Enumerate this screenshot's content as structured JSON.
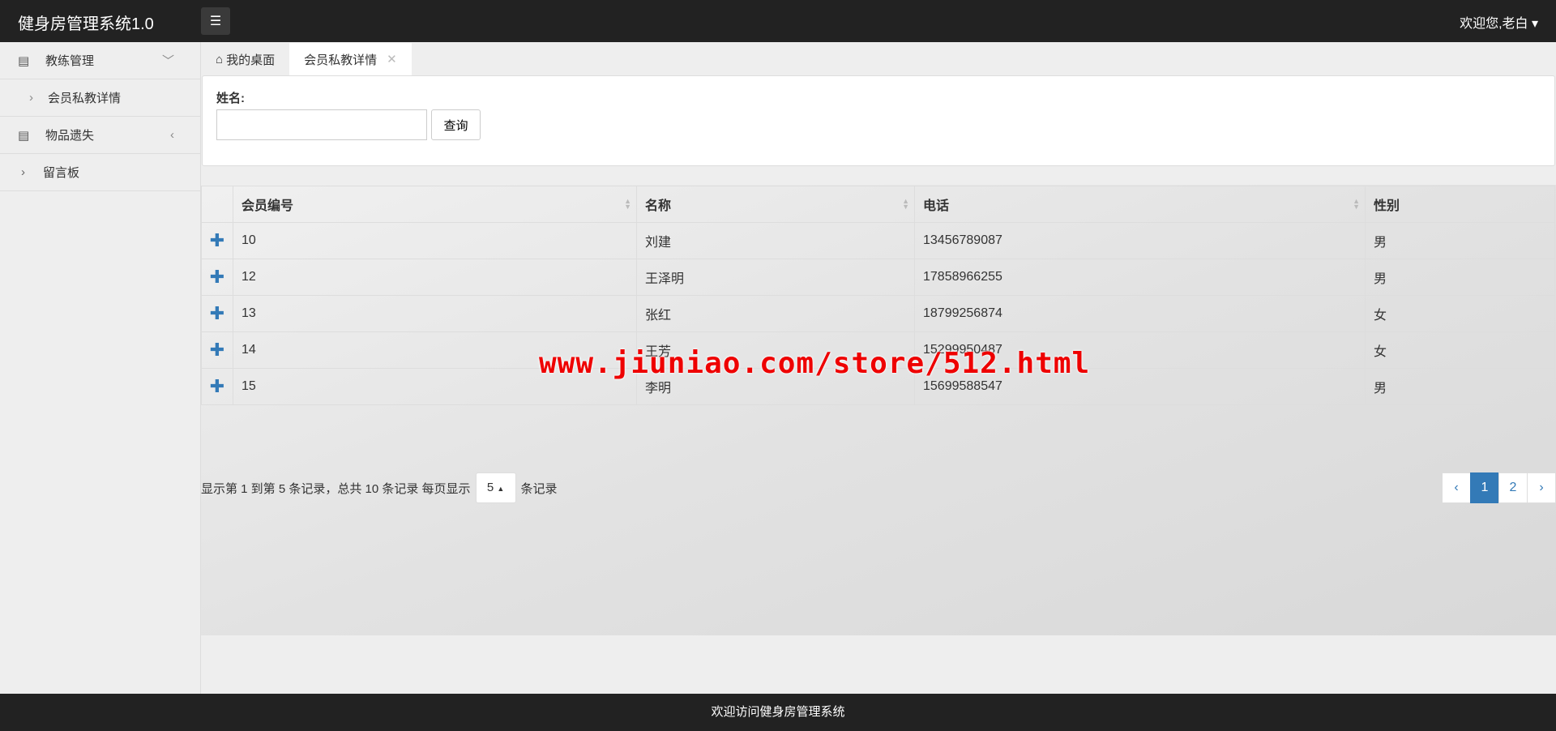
{
  "header": {
    "brand": "健身房管理系统1.0",
    "user": "欢迎您,老白"
  },
  "sidebar": {
    "items": [
      {
        "label": "教练管理",
        "children": [
          "会员私教详情"
        ]
      },
      {
        "label": "物品遗失"
      },
      {
        "label": "留言板"
      }
    ]
  },
  "tabs": [
    {
      "label": "我的桌面"
    },
    {
      "label": "会员私教详情"
    }
  ],
  "search": {
    "label": "姓名:",
    "value": "",
    "button": "查询"
  },
  "table": {
    "columns": [
      "会员编号",
      "名称",
      "电话",
      "性别"
    ],
    "rows": [
      [
        "10",
        "刘建",
        "13456789087",
        "男"
      ],
      [
        "12",
        "王泽明",
        "17858966255",
        "男"
      ],
      [
        "13",
        "张红",
        "18799256874",
        "女"
      ],
      [
        "14",
        "王芳",
        "15299950487",
        "女"
      ],
      [
        "15",
        "李明",
        "15699588547",
        "男"
      ]
    ]
  },
  "pagination": {
    "info": "显示第 1 到第 5 条记录，总共 10 条记录 每页显示",
    "page_size": "5",
    "suffix": "条记录",
    "prev": "‹",
    "pages": [
      "1",
      "2"
    ],
    "next": "›",
    "current": "1"
  },
  "watermark": "www.jiuniao.com/store/512.html",
  "footer": "欢迎访问健身房管理系统"
}
